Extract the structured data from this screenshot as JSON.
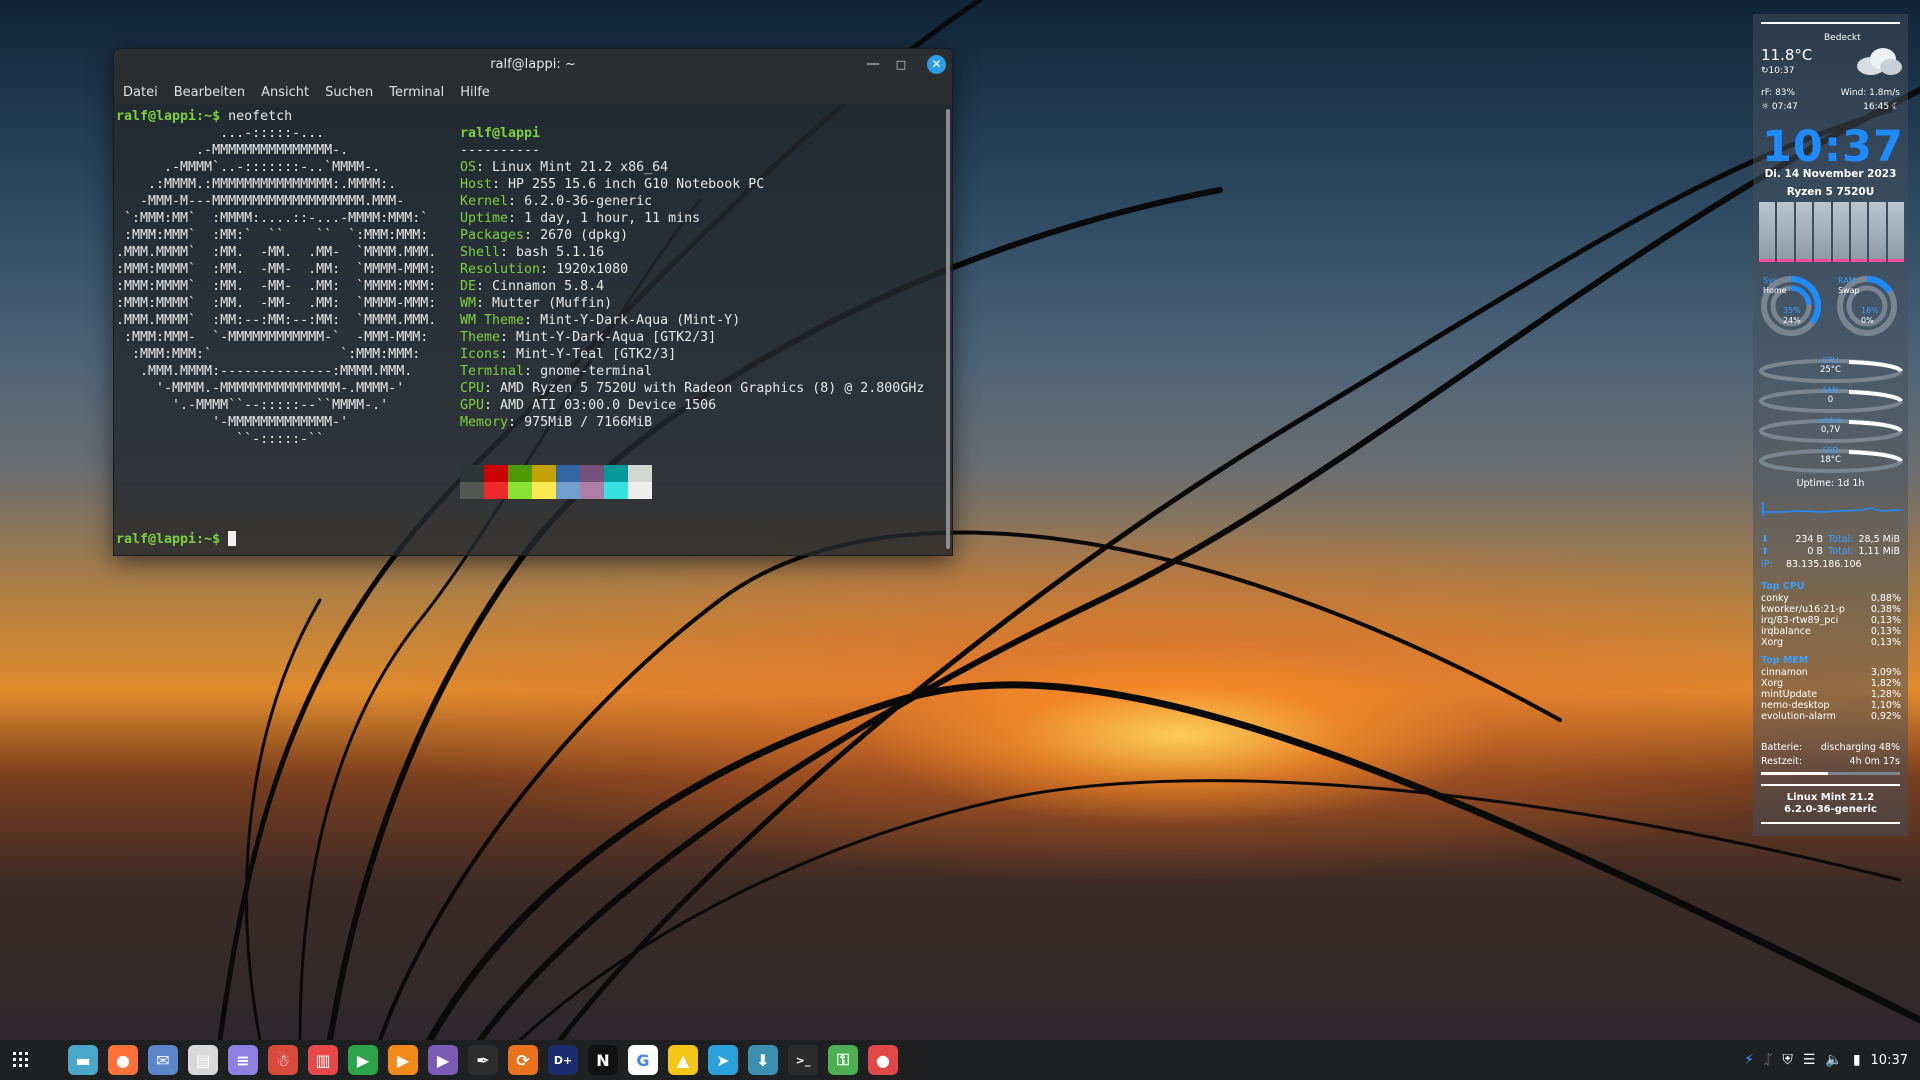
{
  "terminal": {
    "title": "ralf@lappi: ~",
    "menu": [
      "Datei",
      "Bearbeiten",
      "Ansicht",
      "Suchen",
      "Terminal",
      "Hilfe"
    ],
    "command_prompt": "ralf@lappi:~$",
    "command": " neofetch",
    "art": [
      "             ...-:::::-...",
      "          .-MMMMMMMMMMMMMMM-.",
      "      .-MMMM`..-:::::::-..`MMMM-.",
      "    .:MMMM.:MMMMMMMMMMMMMMM:.MMMM:.",
      "   -MMM-M---MMMMMMMMMMMMMMMMMMM.MMM-",
      " `:MMM:MM`  :MMMM:....::-...-MMMM:MMM:`",
      " :MMM:MMM`  :MM:`  ``    ``  `:MMM:MMM:",
      ".MMM.MMMM`  :MM.  -MM.  .MM-  `MMMM.MMM.",
      ":MMM:MMMM`  :MM.  -MM-  .MM:  `MMMM-MMM:",
      ":MMM:MMMM`  :MM.  -MM-  .MM:  `MMMM:MMM:",
      ":MMM:MMMM`  :MM.  -MM-  .MM:  `MMMM-MMM:",
      ".MMM.MMMM`  :MM:--:MM:--:MM:  `MMMM.MMM.",
      " :MMM:MMM-  `-MMMMMMMMMMMM-`  -MMM-MMM:",
      "  :MMM:MMM:`                `:MMM:MMM:",
      "   .MMM.MMMM:--------------:MMMM.MMM.",
      "     '-MMMM.-MMMMMMMMMMMMMMM-.MMMM-'",
      "       '.-MMMM``--:::::--``MMMM-.'",
      "            '-MMMMMMMMMMMMM-'",
      "               ``-:::::-``"
    ],
    "info_header": "ralf@lappi",
    "info_sep": "----------",
    "info": [
      {
        "k": "OS",
        "v": "Linux Mint 21.2 x86_64"
      },
      {
        "k": "Host",
        "v": "HP 255 15.6 inch G10 Notebook PC"
      },
      {
        "k": "Kernel",
        "v": "6.2.0-36-generic"
      },
      {
        "k": "Uptime",
        "v": "1 day, 1 hour, 11 mins"
      },
      {
        "k": "Packages",
        "v": "2670 (dpkg)"
      },
      {
        "k": "Shell",
        "v": "bash 5.1.16"
      },
      {
        "k": "Resolution",
        "v": "1920x1080"
      },
      {
        "k": "DE",
        "v": "Cinnamon 5.8.4"
      },
      {
        "k": "WM",
        "v": "Mutter (Muffin)"
      },
      {
        "k": "WM Theme",
        "v": "Mint-Y-Dark-Aqua (Mint-Y)"
      },
      {
        "k": "Theme",
        "v": "Mint-Y-Dark-Aqua [GTK2/3]"
      },
      {
        "k": "Icons",
        "v": "Mint-Y-Teal [GTK2/3]"
      },
      {
        "k": "Terminal",
        "v": "gnome-terminal"
      },
      {
        "k": "CPU",
        "v": "AMD Ryzen 5 7520U with Radeon Graphics (8) @ 2.800GHz"
      },
      {
        "k": "GPU",
        "v": "AMD ATI 03:00.0 Device 1506"
      },
      {
        "k": "Memory",
        "v": "975MiB / 7166MiB"
      }
    ],
    "palette": [
      "#2e3436",
      "#cc0000",
      "#4e9a06",
      "#c4a000",
      "#3465a4",
      "#75507b",
      "#06989a",
      "#d3d7cf",
      "#555753",
      "#ef2929",
      "#8ae234",
      "#fce94f",
      "#729fcf",
      "#ad7fa8",
      "#34e2e2",
      "#eeeeec"
    ],
    "prompt2": "ralf@lappi:~$"
  },
  "conky": {
    "weather": "Bedeckt",
    "temp": "11.8°C",
    "weather_time": "↻10:37",
    "humidity": "rF: 83%",
    "wind": "Wind: 1.8m/s",
    "sunrise": "☼ 07:47",
    "sunset": "16:45 ☾",
    "clock": "10:37",
    "date": "Di. 14 November 2023",
    "cpu_name": "Ryzen 5 7520U",
    "disk_labels": {
      "sys": "Sys",
      "home": "Home",
      "ram": "RAM",
      "swap": "Swap"
    },
    "disk_values": {
      "sys": "35%",
      "home": "24%",
      "ram": "16%",
      "swap": "0%"
    },
    "gauges": [
      {
        "label": "CPU",
        "value": "25°C"
      },
      {
        "label": "FAN",
        "value": "0"
      },
      {
        "label": "vddnb",
        "value": "0,7V"
      },
      {
        "label": "SSD",
        "value": "18°C"
      }
    ],
    "uptime": "Uptime: 1d 1h",
    "net_down": "234 B",
    "net_down_total_label": "Total:",
    "net_down_total": "28,5 MiB",
    "net_up": "0 B",
    "net_up_total_label": "Total:",
    "net_up_total": "1,11 MiB",
    "ip_label": "IP:",
    "ip": "83.135.186.106",
    "top_cpu_title": "Top CPU",
    "top_cpu": [
      {
        "n": "conky",
        "v": "0,88%"
      },
      {
        "n": "kworker/u16:21-p",
        "v": "0,38%"
      },
      {
        "n": "irq/83-rtw89_pci",
        "v": "0,13%"
      },
      {
        "n": "irqbalance",
        "v": "0,13%"
      },
      {
        "n": "Xorg",
        "v": "0,13%"
      }
    ],
    "top_mem_title": "Top MEM",
    "top_mem": [
      {
        "n": "cinnamon",
        "v": "3,09%"
      },
      {
        "n": "Xorg",
        "v": "1,82%"
      },
      {
        "n": "mintUpdate",
        "v": "1,28%"
      },
      {
        "n": "nemo-desktop",
        "v": "1,10%"
      },
      {
        "n": "evolution-alarm",
        "v": "0,92%"
      }
    ],
    "battery_label": "Batterie:",
    "battery_value": "discharging 48%",
    "battery_level": 0.48,
    "remaining_label": "Restzeit:",
    "remaining_value": "4h 0m 17s",
    "os_name": "Linux Mint 21.2",
    "kernel": "6.2.0-36-generic"
  },
  "taskbar": {
    "apps": [
      {
        "name": "files",
        "color": "#4aa7c9",
        "glyph": "▬"
      },
      {
        "name": "firefox",
        "color": "#ff7139",
        "glyph": "●"
      },
      {
        "name": "mail",
        "color": "#5b86c9",
        "glyph": "✉"
      },
      {
        "name": "text-editor",
        "color": "#d9d9d9",
        "glyph": "▤"
      },
      {
        "name": "notes",
        "color": "#8f7fe0",
        "glyph": "≡"
      },
      {
        "name": "gimp",
        "color": "#d84a3b",
        "glyph": "☃"
      },
      {
        "name": "book-reader",
        "color": "#e84848",
        "glyph": "▥"
      },
      {
        "name": "play-store",
        "color": "#2aa34a",
        "glyph": "▶"
      },
      {
        "name": "media-player",
        "color": "#f28a1a",
        "glyph": "▶"
      },
      {
        "name": "video-player",
        "color": "#7b5bb5",
        "glyph": "▶"
      },
      {
        "name": "inkscape",
        "color": "#2d2d2d",
        "glyph": "✒"
      },
      {
        "name": "timeshift",
        "color": "#e8731a",
        "glyph": "⟳"
      },
      {
        "name": "disney-plus",
        "color": "#1a2c6b",
        "glyph": "D+"
      },
      {
        "name": "netflix",
        "color": "#111111",
        "glyph": "N"
      },
      {
        "name": "google",
        "color": "#ffffff",
        "glyph": "G"
      },
      {
        "name": "google-drive",
        "color": "#f5c518",
        "glyph": "▲"
      },
      {
        "name": "telegram",
        "color": "#2aa1da",
        "glyph": "➤"
      },
      {
        "name": "software-manager",
        "color": "#3d8fb0",
        "glyph": "⬇"
      },
      {
        "name": "terminal",
        "color": "#2b2b2b",
        "glyph": ">_"
      },
      {
        "name": "key-manager",
        "color": "#4caf50",
        "glyph": "⚿"
      },
      {
        "name": "screen-recorder",
        "color": "#e04848",
        "glyph": "●"
      }
    ],
    "clock": "10:37"
  }
}
